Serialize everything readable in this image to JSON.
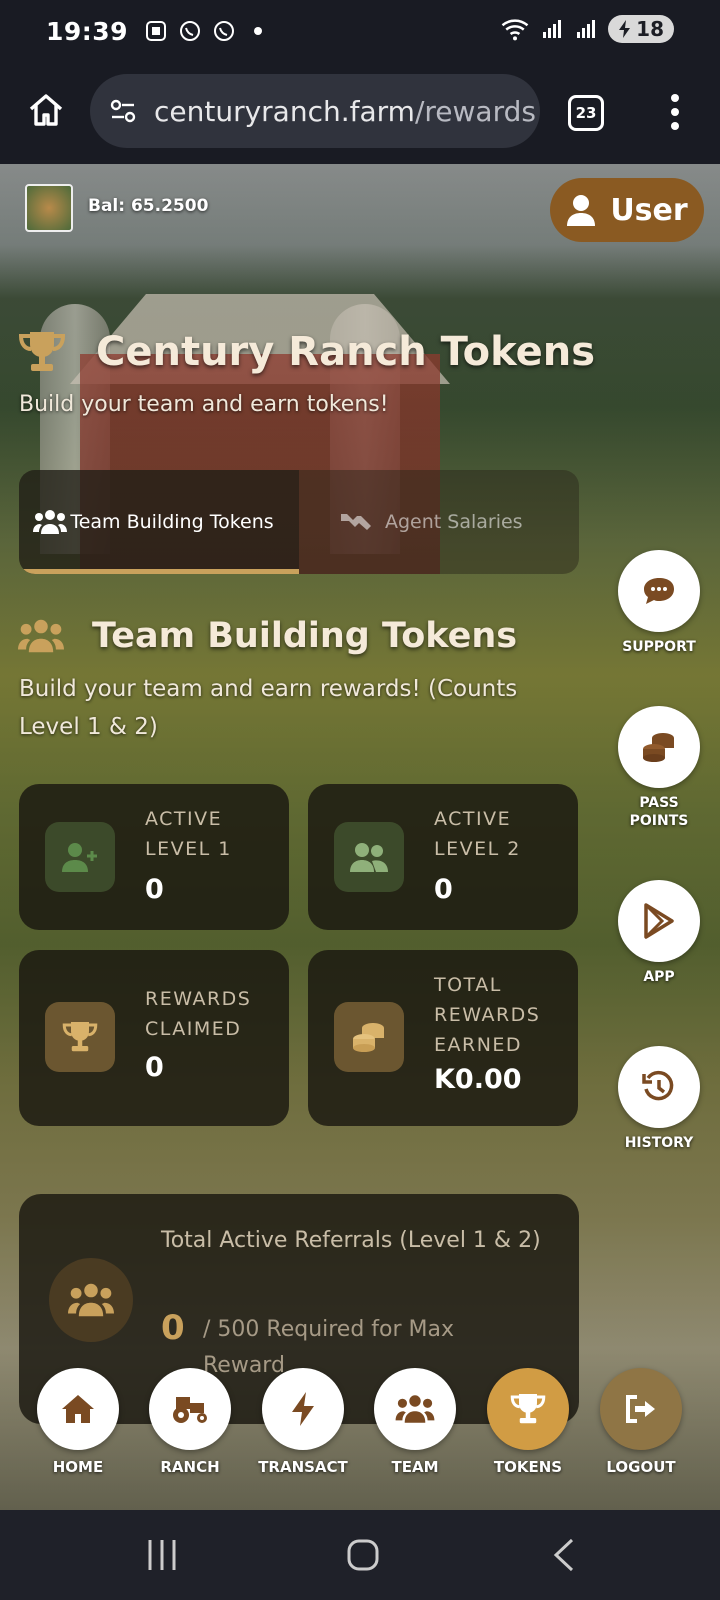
{
  "status_bar": {
    "time": "19:39",
    "battery": "18",
    "icons": [
      "screenshot-icon",
      "whatsapp-icon",
      "whatsapp-icon",
      "dot-icon",
      "wifi-icon",
      "signal-icon",
      "signal-icon",
      "battery-charging-icon"
    ]
  },
  "browser": {
    "url_domain": "centuryranch.farm",
    "url_path": "/rewards",
    "tab_count": "23"
  },
  "header": {
    "balance": "Bal: 65.2500",
    "user_label": "User"
  },
  "page": {
    "title": "Century Ranch Tokens",
    "subtitle": "Build your team and earn tokens!",
    "tabs": [
      {
        "label": "Team Building Tokens",
        "icon": "users-icon",
        "active": true
      },
      {
        "label": "Agent Salaries",
        "icon": "handshake-icon",
        "active": false
      }
    ]
  },
  "section": {
    "title": "Team Building Tokens",
    "subtitle": "Build your team and earn rewards! (Counts Level 1 & 2)"
  },
  "stats": [
    {
      "label": "ACTIVE LEVEL 1",
      "value": "0",
      "icon": "user-plus-icon"
    },
    {
      "label": "ACTIVE LEVEL 2",
      "value": "0",
      "icon": "users-icon"
    },
    {
      "label": "REWARDS CLAIMED",
      "value": "0",
      "icon": "trophy-icon"
    },
    {
      "label": "TOTAL REWARDS EARNED",
      "value": "K0.00",
      "icon": "coins-icon"
    }
  ],
  "referrals": {
    "title": "Total Active Referrals (Level 1 & 2)",
    "count": "0",
    "requirement": "/ 500 Required for Max Reward"
  },
  "side_buttons": [
    {
      "label": "SUPPORT",
      "icon": "chat-icon"
    },
    {
      "label": "PASS POINTS",
      "icon": "coins-icon"
    },
    {
      "label": "APP",
      "icon": "play-store-icon"
    },
    {
      "label": "HISTORY",
      "icon": "history-icon"
    }
  ],
  "bottom_nav": [
    {
      "label": "HOME",
      "icon": "home-icon"
    },
    {
      "label": "RANCH",
      "icon": "tractor-icon"
    },
    {
      "label": "TRANSACT",
      "icon": "bolt-icon"
    },
    {
      "label": "TEAM",
      "icon": "users-icon"
    },
    {
      "label": "TOKENS",
      "icon": "trophy-icon",
      "active": true
    },
    {
      "label": "LOGOUT",
      "icon": "logout-icon"
    }
  ],
  "colors": {
    "accent_gold": "#c9a15c",
    "user_button": "#8a5a22",
    "active_nav": "#d19c44",
    "icon_brown": "#7a4a22"
  }
}
